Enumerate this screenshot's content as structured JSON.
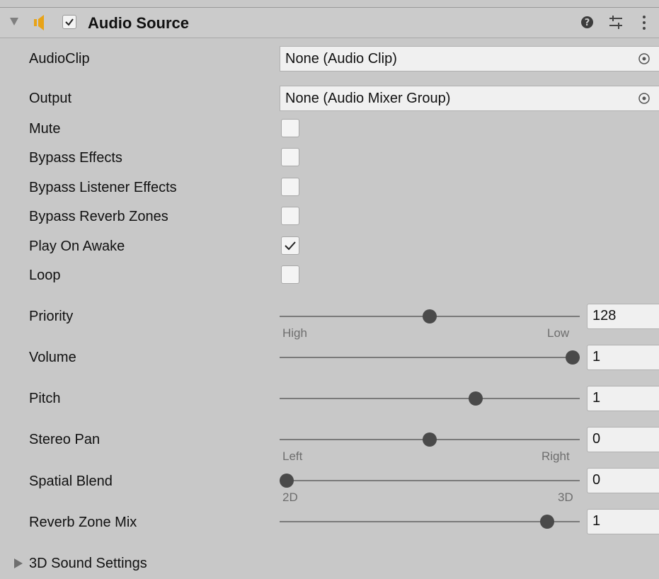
{
  "component": {
    "title": "Audio Source",
    "enabled": true,
    "icons": {
      "foldout": "triangle-down-icon",
      "component": "speaker-icon",
      "help": "help-icon",
      "presets": "presets-icon",
      "menu": "kebab-menu-icon"
    }
  },
  "fields": {
    "audio_clip": {
      "label": "AudioClip",
      "value": "None (Audio Clip)"
    },
    "output": {
      "label": "Output",
      "value": "None (Audio Mixer Group)"
    }
  },
  "toggles": [
    {
      "label": "Mute",
      "checked": false
    },
    {
      "label": "Bypass Effects",
      "checked": false
    },
    {
      "label": "Bypass Listener Effects",
      "checked": false
    },
    {
      "label": "Bypass Reverb Zones",
      "checked": false
    },
    {
      "label": "Play On Awake",
      "checked": true
    },
    {
      "label": "Loop",
      "checked": false
    }
  ],
  "sliders": [
    {
      "label": "Priority",
      "value": "128",
      "fraction": 0.5,
      "min_label": "High",
      "max_label": "Low"
    },
    {
      "label": "Volume",
      "value": "1",
      "fraction": 1.0
    },
    {
      "label": "Pitch",
      "value": "1",
      "fraction": 0.66
    },
    {
      "label": "Stereo Pan",
      "value": "0",
      "fraction": 0.5,
      "min_label": "Left",
      "max_label": "Right"
    },
    {
      "label": "Spatial Blend",
      "value": "0",
      "fraction": 0.0,
      "min_label": "2D",
      "max_label": "3D"
    },
    {
      "label": "Reverb Zone Mix",
      "value": "1",
      "fraction": 0.91
    }
  ],
  "footer": {
    "label": "3D Sound Settings",
    "expanded": false
  },
  "colors": {
    "accent_orange": "#e8a317",
    "background": "#c8c8c8",
    "field": "#f0f0f0"
  }
}
